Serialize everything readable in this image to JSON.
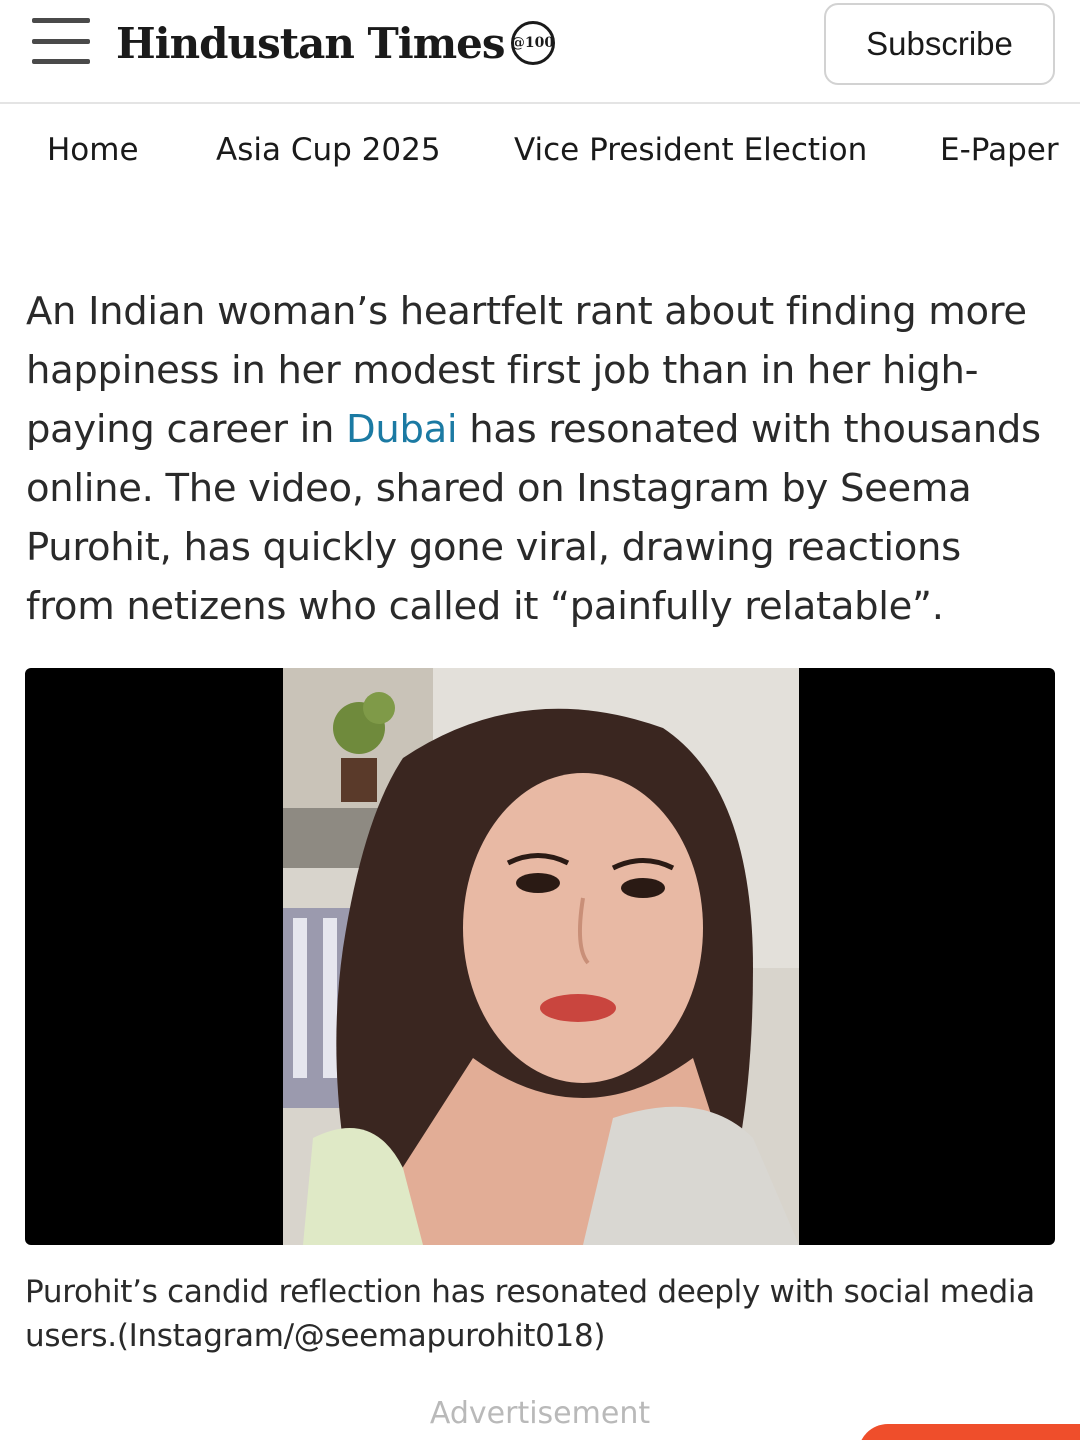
{
  "header": {
    "logo_text": "Hindustan Times",
    "logo_badge": "@100",
    "subscribe_label": "Subscribe"
  },
  "nav": {
    "items": [
      {
        "label": "Home"
      },
      {
        "label": "Asia Cup 2025"
      },
      {
        "label": "Vice President Election"
      },
      {
        "label": "E-Paper"
      }
    ]
  },
  "article": {
    "intro_before_link": "An Indian woman’s heartfelt rant about finding more happiness in her modest first job than in her high-paying career in ",
    "link_text": "Dubai",
    "intro_after_link": " has resonated with thousands online. The video, shared on Instagram by Seema Purohit, has quickly gone viral, drawing reactions from netizens who called it “painfully relatable”.",
    "caption": "Purohit’s candid reflection has resonated deeply with social media users.(Instagram/@seemapurohit018)"
  },
  "footer": {
    "advertisement_label": "Advertisement"
  },
  "colors": {
    "link": "#1b7aa3",
    "accent": "#ef4e2b"
  },
  "icons": {
    "menu": "hamburger-menu-icon"
  }
}
